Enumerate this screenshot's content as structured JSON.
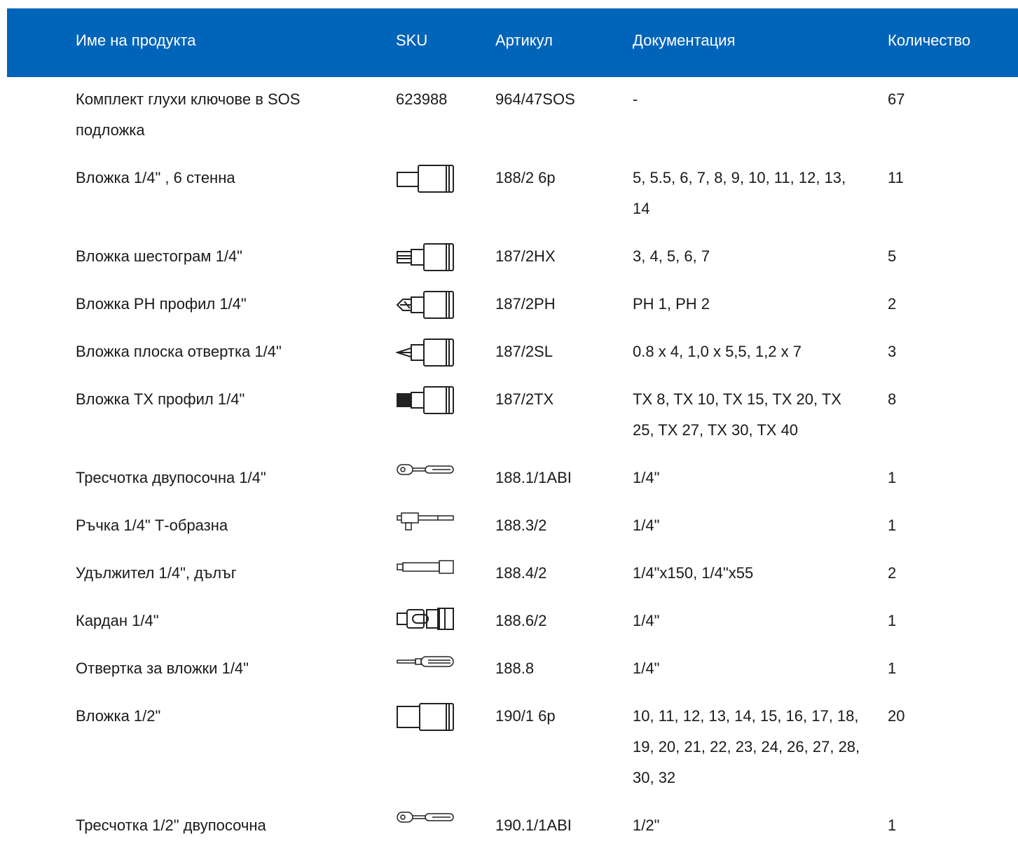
{
  "table": {
    "headers": {
      "name": "Име на продукта",
      "sku": "SKU",
      "article": "Артикул",
      "documentation": "Документация",
      "quantity": "Количество"
    },
    "rows": [
      {
        "name": "Комплект глухи ключове в SOS подложка",
        "sku": "623988",
        "icon": null,
        "article": "964/47SOS",
        "documentation": "-",
        "quantity": "67"
      },
      {
        "name": "Вложка 1/4\" , 6 стенна",
        "sku": "",
        "icon": "socket-icon",
        "article": "188/2 6p",
        "documentation": "5, 5.5, 6, 7, 8, 9, 10, 11, 12, 13, 14",
        "quantity": "11"
      },
      {
        "name": "Вложка шестограм 1/4\"",
        "sku": "",
        "icon": "hex-bit-socket-icon",
        "article": "187/2HX",
        "documentation": "3, 4, 5, 6, 7",
        "quantity": "5"
      },
      {
        "name": "Вложка PH профил 1/4\"",
        "sku": "",
        "icon": "phillips-bit-socket-icon",
        "article": "187/2PH",
        "documentation": "PH 1, PH 2",
        "quantity": "2"
      },
      {
        "name": "Вложка плоска отвертка 1/4\"",
        "sku": "",
        "icon": "flat-bit-socket-icon",
        "article": "187/2SL",
        "documentation": "0.8 x 4, 1,0 x 5,5, 1,2 x 7",
        "quantity": "3"
      },
      {
        "name": "Вложка TX профил 1/4\"",
        "sku": "",
        "icon": "torx-bit-socket-icon",
        "article": "187/2TX",
        "documentation": "TX 8, TX 10, TX 15, TX 20, TX 25, TX 27, TX 30, TX 40",
        "quantity": "8"
      },
      {
        "name": "Тресчотка двупосочна 1/4\"",
        "sku": "",
        "icon": "ratchet-icon",
        "article": "188.1/1ABI",
        "documentation": "1/4\"",
        "quantity": "1"
      },
      {
        "name": "Ръчка 1/4\" Т-образна",
        "sku": "",
        "icon": "t-handle-icon",
        "article": "188.3/2",
        "documentation": "1/4\"",
        "quantity": "1"
      },
      {
        "name": "Удължител 1/4\", дълъг",
        "sku": "",
        "icon": "extension-bar-icon",
        "article": "188.4/2",
        "documentation": "1/4\"x150, 1/4\"x55",
        "quantity": "2"
      },
      {
        "name": "Кардан 1/4\"",
        "sku": "",
        "icon": "universal-joint-icon",
        "article": "188.6/2",
        "documentation": "1/4\"",
        "quantity": "1"
      },
      {
        "name": "Отвертка за вложки 1/4\"",
        "sku": "",
        "icon": "spinner-handle-icon",
        "article": "188.8",
        "documentation": "1/4\"",
        "quantity": "1"
      },
      {
        "name": "Вложка 1/2\"",
        "sku": "",
        "icon": "socket-icon",
        "article": "190/1 6p",
        "documentation": "10, 11, 12, 13, 14, 15, 16, 17, 18, 19, 20, 21, 22, 23, 24, 26, 27, 28, 30, 32",
        "quantity": "20"
      },
      {
        "name": "Тресчотка 1/2\" двупосочна",
        "sku": "",
        "icon": "ratchet-icon",
        "article": "190.1/1ABI",
        "documentation": "1/2\"",
        "quantity": "1"
      }
    ]
  },
  "colors": {
    "header_bg": "#0064b9",
    "header_text": "#ffffff",
    "text": "#1a1a1a"
  }
}
